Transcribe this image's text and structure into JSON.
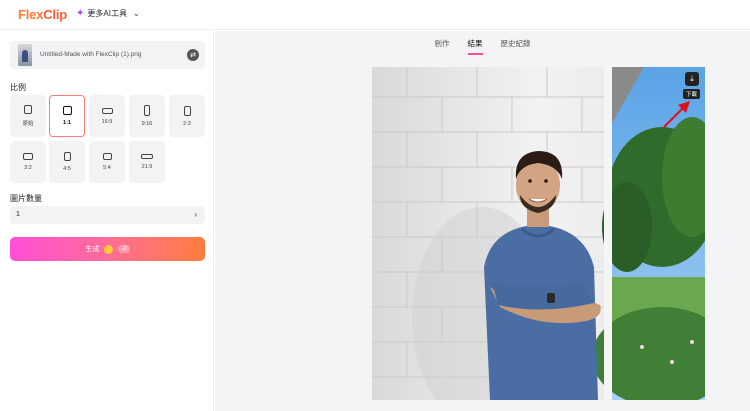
{
  "header": {
    "logo_prefix": "Flex",
    "logo_suffix": "Clip",
    "ai_tools_label": "更多AI工具"
  },
  "left_panel": {
    "file_name": "Untitled-Made with FlexClip (1).png",
    "ratio_label": "比例",
    "ratios": [
      "原始",
      "1:1",
      "16:9",
      "9:16",
      "2:3",
      "3:2",
      "4:5",
      "5:4",
      "21:9"
    ],
    "selected_ratio": "1:1",
    "count_label": "圖片數量",
    "count_value": "1",
    "generate_label": "生成",
    "generate_cost": "-2"
  },
  "tabs": [
    "創作",
    "結果",
    "歷史紀錄"
  ],
  "active_tab": "結果",
  "download_tooltip": "下載",
  "colors": {
    "brand_orange": "#ff7a32",
    "tab_underline": "#ff4f8a",
    "selected_border": "#ff7a7a",
    "annotation_arrow": "#e0101a"
  }
}
